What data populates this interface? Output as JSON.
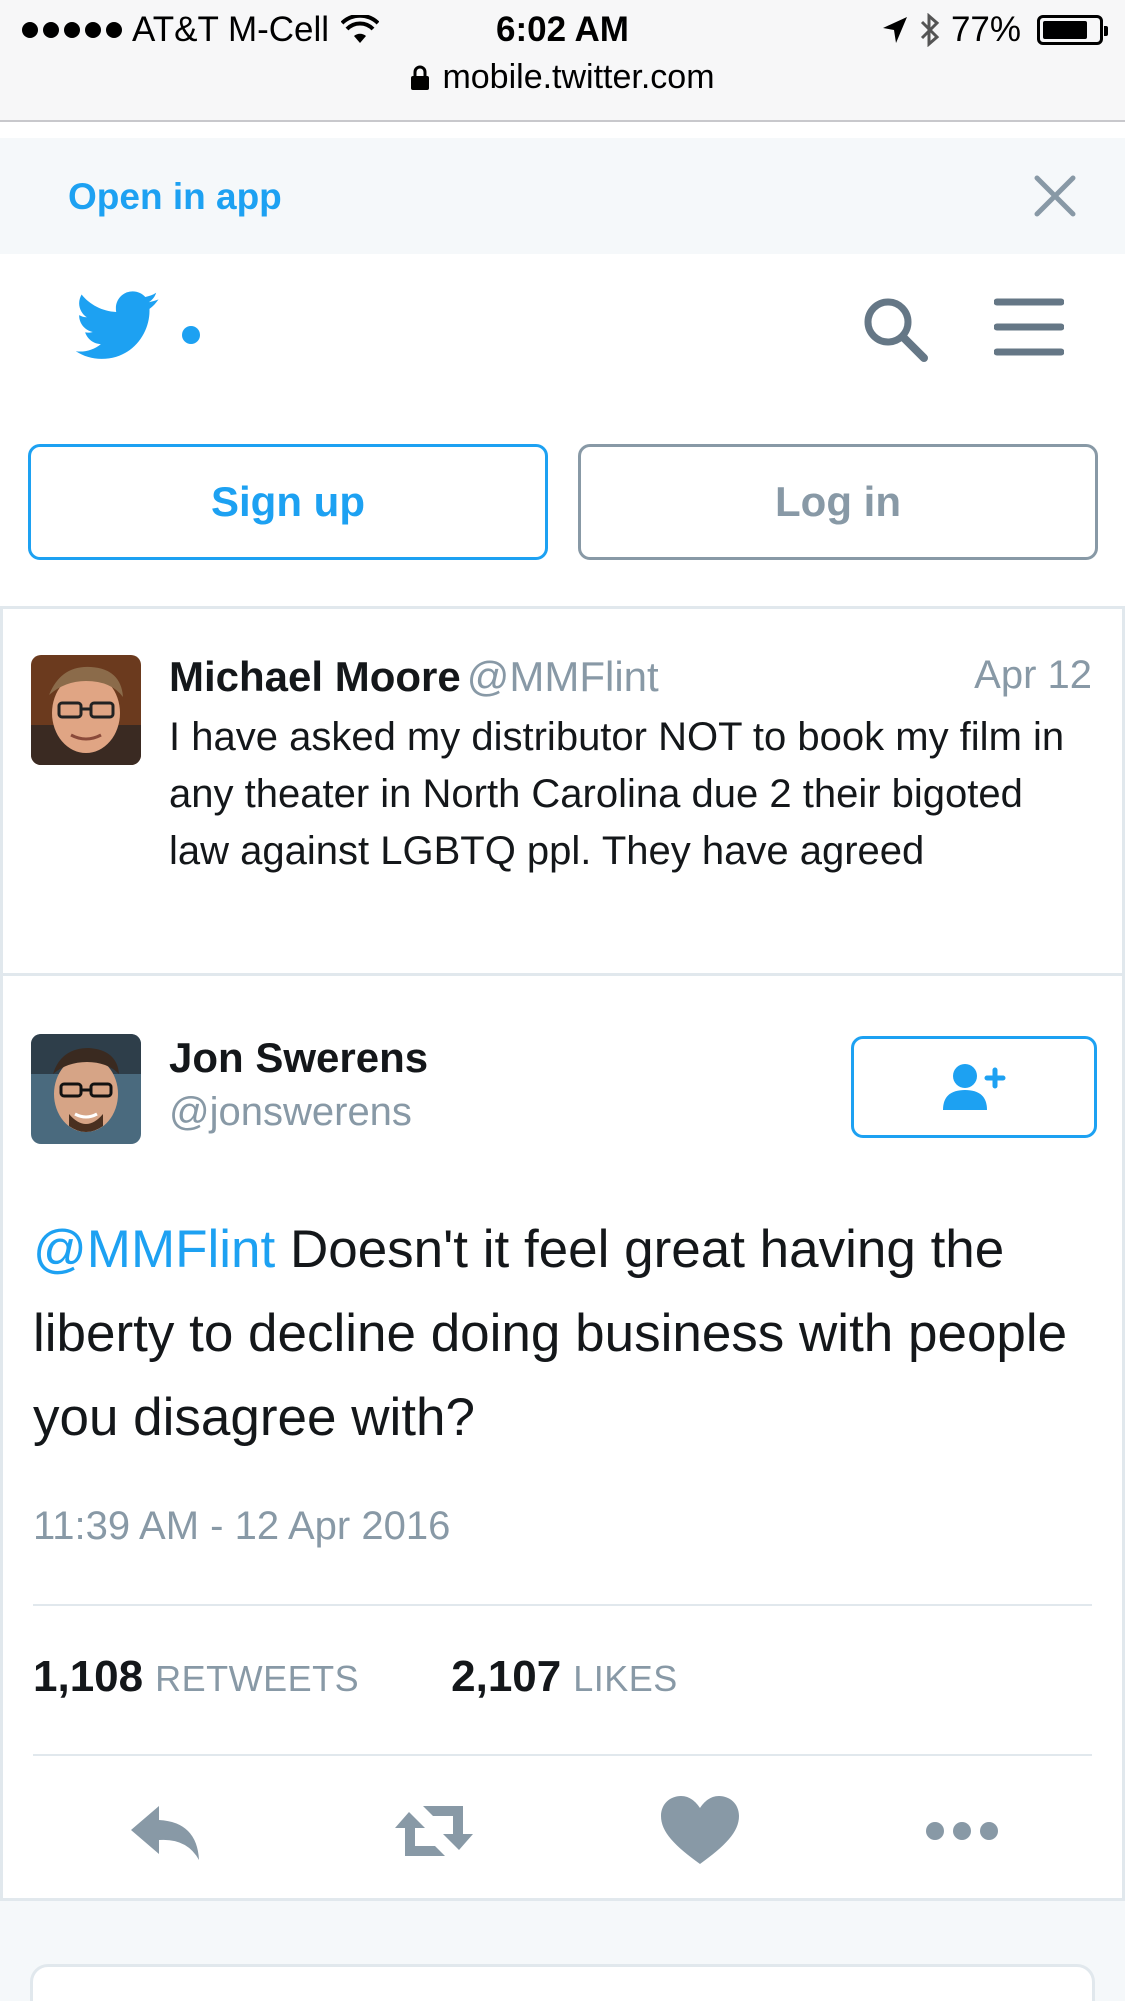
{
  "status_bar": {
    "carrier": "AT&T M-Cell",
    "time": "6:02 AM",
    "battery": "77%",
    "url": "mobile.twitter.com"
  },
  "banner": {
    "open_in_app": "Open in app"
  },
  "header": {
    "signup_label": "Sign up",
    "login_label": "Log in"
  },
  "parent_tweet": {
    "name": "Michael Moore",
    "handle": "@MMFlint",
    "date": "Apr 12",
    "text": "I have asked my distributor NOT to book my film in any theater in North Carolina due 2 their bigoted law against LGBTQ ppl. They have agreed"
  },
  "main_tweet": {
    "name": "Jon Swerens",
    "handle": "@jonswerens",
    "mention": "@MMFlint",
    "text": " Doesn't it feel great having the liberty to decline doing business with people you disagree with?",
    "timestamp": "11:39 AM - 12 Apr 2016",
    "retweets_count": "1,108",
    "retweets_label": "RETWEETS",
    "likes_count": "2,107",
    "likes_label": "LIKES"
  },
  "colors": {
    "brand": "#1da1f2",
    "muted": "#8899a6",
    "text": "#14171a"
  },
  "icons": [
    "signal-dots-icon",
    "wifi-icon",
    "location-arrow-icon",
    "bluetooth-icon",
    "battery-icon",
    "lock-icon",
    "close-icon",
    "twitter-bird-icon",
    "search-icon",
    "menu-icon",
    "follow-user-icon",
    "reply-icon",
    "retweet-icon",
    "like-icon",
    "more-icon"
  ]
}
